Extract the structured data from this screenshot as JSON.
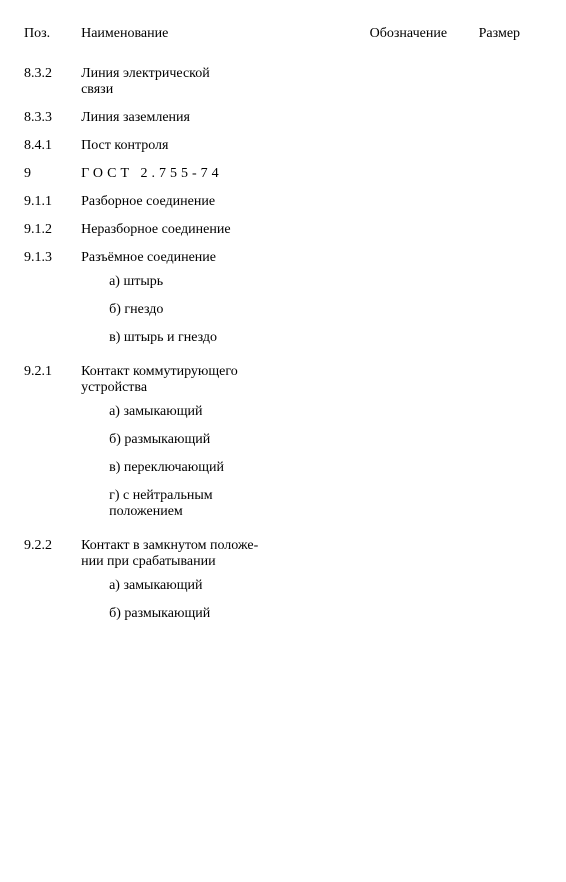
{
  "columns": {
    "pos": "Поз.",
    "name": "Наименование",
    "symbol": "Обозначение",
    "size": "Размер"
  },
  "rows": [
    {
      "pos": "8.3.2",
      "name": "Линия электрической\nсвязи",
      "subs": [],
      "top_pad": true
    },
    {
      "pos": "8.3.3",
      "name": "Линия заземления",
      "subs": [],
      "top_pad": true
    },
    {
      "pos": "8.4.1",
      "name": "Пост контроля",
      "subs": [],
      "top_pad": true
    },
    {
      "pos": "9",
      "name": "ГОСТ 2.755-74",
      "section": true
    },
    {
      "pos": "9.1.1",
      "name": "Разборное соединение",
      "subs": []
    },
    {
      "pos": "9.1.2",
      "name": "Неразборное соединение",
      "subs": []
    },
    {
      "pos": "9.1.3",
      "name": "Разъёмное соединение",
      "subs": [
        "а) штырь",
        "б) гнездо",
        "в) штырь и гнездо"
      ]
    },
    {
      "pos": "9.2.1",
      "name": "Контакт коммутирующего\nустройства",
      "subs": [
        "а) замыкающий",
        "б) размыкающий",
        "в) переключающий",
        "г) с нейтральным\nположением"
      ]
    },
    {
      "pos": "9.2.2",
      "name": "Контакт в замкнутом положе-\nнии при срабатывании",
      "subs": [
        "а) замыкающий",
        "б) размыкающий"
      ]
    }
  ]
}
